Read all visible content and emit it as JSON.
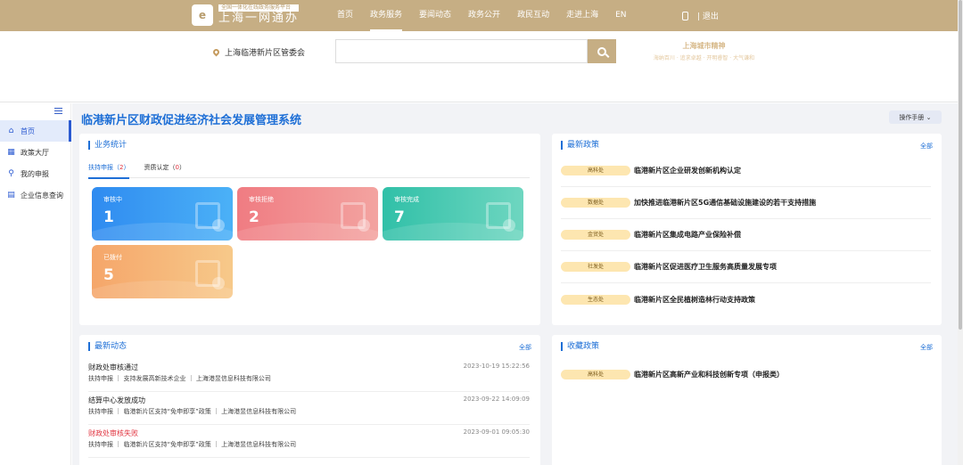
{
  "header": {
    "logo_subtitle": "全国一体化在线政务服务平台",
    "logo_title": "上海一网通办",
    "nav": [
      "首页",
      "政务服务",
      "要闻动态",
      "政务公开",
      "政民互动",
      "走进上海",
      "EN"
    ],
    "logout": "| 退出"
  },
  "search": {
    "location": "上海临港新片区管委会",
    "placeholder": "",
    "spirit_title": "上海城市精神",
    "spirit_sub": "海纳百川 · 追求卓越 · 开明睿智 · 大气谦和"
  },
  "sidebar": {
    "items": [
      "首页",
      "政策大厅",
      "我的申报",
      "企业信息查询"
    ]
  },
  "page": {
    "title": "临港新片区财政促进经济社会发展管理系统",
    "manual_button": "操作手册"
  },
  "stats_card": {
    "title": "业务统计",
    "tabs": [
      {
        "label": "扶持申报",
        "count": "2"
      },
      {
        "label": "资质认定",
        "count": "0"
      }
    ],
    "tiles": [
      {
        "label": "审核中",
        "value": "1"
      },
      {
        "label": "审核拒绝",
        "value": "2"
      },
      {
        "label": "审核完成",
        "value": "7"
      },
      {
        "label": "已拨付",
        "value": "5"
      }
    ]
  },
  "latest_policies": {
    "title": "最新政策",
    "more": "全部",
    "items": [
      {
        "dept": "高科处",
        "text": "临港新片区企业研发创新机构认定"
      },
      {
        "dept": "数据处",
        "text": "加快推进临港新片区5G通信基础设施建设的若干支持措施"
      },
      {
        "dept": "金贸处",
        "text": "临港新片区集成电路产业保险补偿"
      },
      {
        "dept": "社发处",
        "text": "临港新片区促进医疗卫生服务高质量发展专项"
      },
      {
        "dept": "生态处",
        "text": "临港新片区全民植树造林行动支持政策"
      }
    ]
  },
  "news": {
    "title": "最新动态",
    "more": "全部",
    "items": [
      {
        "title": "财政处审核通过",
        "time": "2023-10-19 15:22:56",
        "sub": "扶持申报 ｜ 支持发展高新技术企业 ｜ 上海港昱信息科技有限公司",
        "fail": false
      },
      {
        "title": "结算中心发放成功",
        "time": "2023-09-22 14:09:09",
        "sub": "扶持申报 ｜ 临港新片区支持“免申即享”政策 ｜ 上海港昱信息科技有限公司",
        "fail": false
      },
      {
        "title": "财政处审核失败",
        "time": "2023-09-01 09:05:30",
        "sub": "扶持申报 ｜ 临港新片区支持“免申即享”政策 ｜ 上海港昱信息科技有限公司",
        "fail": true
      }
    ]
  },
  "favorites": {
    "title": "收藏政策",
    "more": "全部",
    "items": [
      {
        "dept": "高科处",
        "text": "临港新片区高新产业和科技创新专项（申报类）"
      }
    ]
  }
}
